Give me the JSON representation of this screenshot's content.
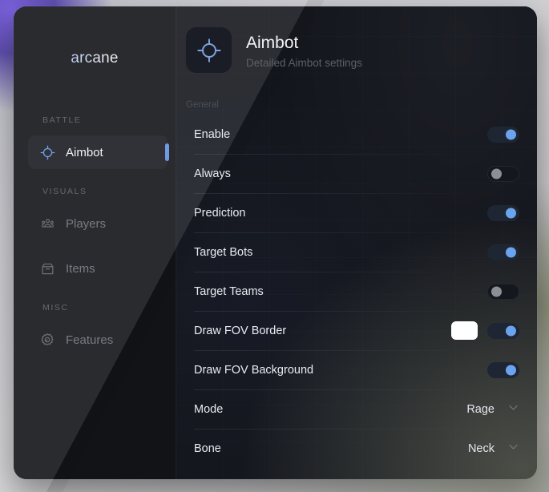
{
  "app": {
    "brand": "arcane"
  },
  "sidebar": {
    "groups": [
      {
        "heading": "BATTLE",
        "items": [
          {
            "label": "Aimbot",
            "icon": "crosshair-icon",
            "active": true
          }
        ]
      },
      {
        "heading": "VISUALS",
        "items": [
          {
            "label": "Players",
            "icon": "players-icon",
            "active": false
          },
          {
            "label": "Items",
            "icon": "box-icon",
            "active": false
          }
        ]
      },
      {
        "heading": "MISC",
        "items": [
          {
            "label": "Features",
            "icon": "gear-icon",
            "active": false
          }
        ]
      }
    ]
  },
  "header": {
    "icon": "crosshair-icon",
    "title": "Aimbot",
    "subtitle": "Detailed Aimbot settings"
  },
  "section": {
    "label": "General"
  },
  "settings": [
    {
      "label": "Enable",
      "control": "toggle",
      "value": "on"
    },
    {
      "label": "Always",
      "control": "toggle",
      "value": "off"
    },
    {
      "label": "Prediction",
      "control": "toggle",
      "value": "on"
    },
    {
      "label": "Target Bots",
      "control": "toggle",
      "value": "on"
    },
    {
      "label": "Target Teams",
      "control": "toggle",
      "value": "off"
    },
    {
      "label": "Draw FOV Border",
      "control": "color+toggle",
      "value": "on",
      "color": "#FFFFFF"
    },
    {
      "label": "Draw FOV Background",
      "control": "toggle",
      "value": "on"
    },
    {
      "label": "Mode",
      "control": "dropdown",
      "value": "Rage"
    },
    {
      "label": "Bone",
      "control": "dropdown",
      "value": "Neck"
    }
  ],
  "colors": {
    "accent": "#6BA4EE",
    "active_indicator": "#5C8FE0",
    "sidebar_bg": "#121317",
    "panel_bg": "#14161D",
    "swatch_white": "#FFFFFF"
  }
}
